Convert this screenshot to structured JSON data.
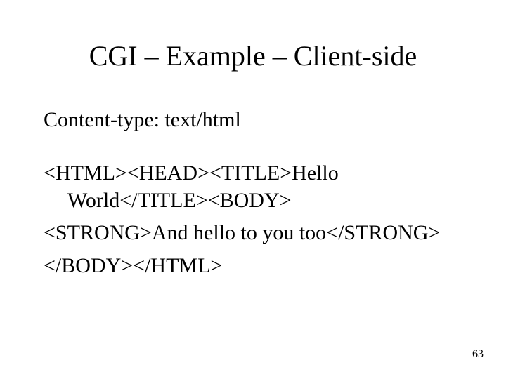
{
  "title": "CGI – Example – Client-side",
  "content_type_line": "Content-type: text/html",
  "code": {
    "l1": "<HTML><HEAD><TITLE>Hello World</TITLE><BODY>",
    "l2": "<STRONG>And hello to you too</STRONG>",
    "l3": "</BODY></HTML>"
  },
  "page_number": "63"
}
